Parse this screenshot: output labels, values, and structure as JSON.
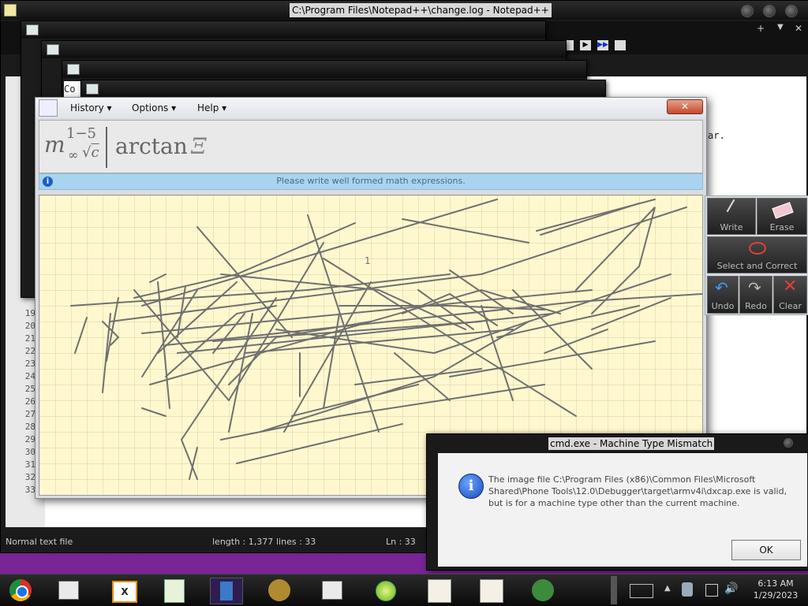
{
  "notepad": {
    "title": "C:\\Program Files\\Notepad++\\change.log - Notepad++",
    "partial_text_1": "Co",
    "partial_text_2": "ar.",
    "line_numbers": [
      "19",
      "20",
      "21",
      "22",
      "23",
      "24",
      "25",
      "26",
      "27",
      "28",
      "29",
      "30",
      "31",
      "32",
      "33"
    ],
    "status": {
      "file_type": "Normal text file",
      "length": "length : 1,377",
      "lines": "lines : 33",
      "position": "Ln : 33"
    }
  },
  "math_panel": {
    "menu": {
      "history": "History",
      "options": "Options",
      "help": "Help"
    },
    "close_label": "✕",
    "preview_expression": "arctan",
    "preview_symbol": "Ξ",
    "preview_m": "m",
    "preview_sup": "1−5",
    "preview_sub": "∞",
    "preview_root": "c",
    "info_text": "Please write well formed math expressions.",
    "canvas_mark": "1",
    "tools": {
      "write": "Write",
      "erase": "Erase",
      "select_correct": "Select and Correct",
      "undo": "Undo",
      "redo": "Redo",
      "clear": "Clear"
    },
    "colors": {
      "canvas": "#fff8cf",
      "ink": "#707070",
      "info_bar": "#a9d4ef"
    }
  },
  "dialog": {
    "title": "cmd.exe - Machine Type Mismatch",
    "message": "The image file C:\\Program Files (x86)\\Common Files\\Microsoft Shared\\Phone Tools\\12.0\\Debugger\\target\\armv4i\\dxcap.exe is valid, but is for a machine type other than the current machine.",
    "ok_label": "OK"
  },
  "taskbar": {
    "apps": [
      "chrome-icon",
      "notepad-icon",
      "xmind-icon",
      "editor-icon",
      "exit-icon",
      "gimp-icon",
      "window-icon",
      "lime-icon",
      "cat-icon",
      "cat2-icon",
      "avatar-icon"
    ],
    "time": "6:13 AM",
    "date": "1/29/2023"
  }
}
